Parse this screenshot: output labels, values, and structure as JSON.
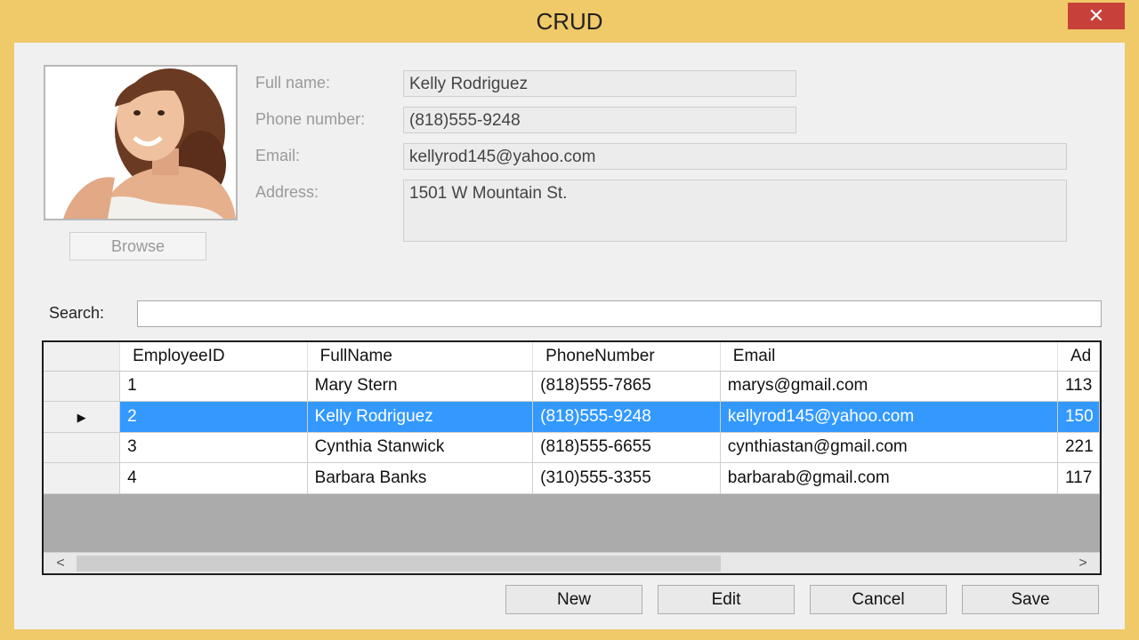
{
  "window": {
    "title": "CRUD",
    "close_glyph": "✕"
  },
  "photo": {
    "description_icon": "person-photo-icon"
  },
  "browse_label": "Browse",
  "form": {
    "full_name_label": "Full name:",
    "full_name_value": "Kelly Rodriguez",
    "phone_label": "Phone number:",
    "phone_value": "(818)555-9248",
    "email_label": "Email:",
    "email_value": "kellyrod145@yahoo.com",
    "address_label": "Address:",
    "address_value": "1501 W Mountain St."
  },
  "search": {
    "label": "Search:",
    "value": ""
  },
  "grid": {
    "columns": [
      "EmployeeID",
      "FullName",
      "PhoneNumber",
      "Email",
      "Ad"
    ],
    "rows": [
      {
        "id": "1",
        "name": "Mary Stern",
        "phone": "(818)555-7865",
        "email": "marys@gmail.com",
        "addr": "113"
      },
      {
        "id": "2",
        "name": "Kelly Rodriguez",
        "phone": "(818)555-9248",
        "email": "kellyrod145@yahoo.com",
        "addr": "150"
      },
      {
        "id": "3",
        "name": "Cynthia Stanwick",
        "phone": "(818)555-6655",
        "email": "cynthiastan@gmail.com",
        "addr": "221"
      },
      {
        "id": "4",
        "name": "Barbara Banks",
        "phone": "(310)555-3355",
        "email": "barbarab@gmail.com",
        "addr": "117"
      }
    ],
    "selected_row_marker": "▶",
    "scroll_left": "<",
    "scroll_right": ">"
  },
  "buttons": {
    "new": "New",
    "edit": "Edit",
    "cancel": "Cancel",
    "save": "Save"
  },
  "colors": {
    "frame": "#f0c968",
    "close": "#c7413a",
    "selection": "#3399ff",
    "grid_empty": "#ababab"
  }
}
